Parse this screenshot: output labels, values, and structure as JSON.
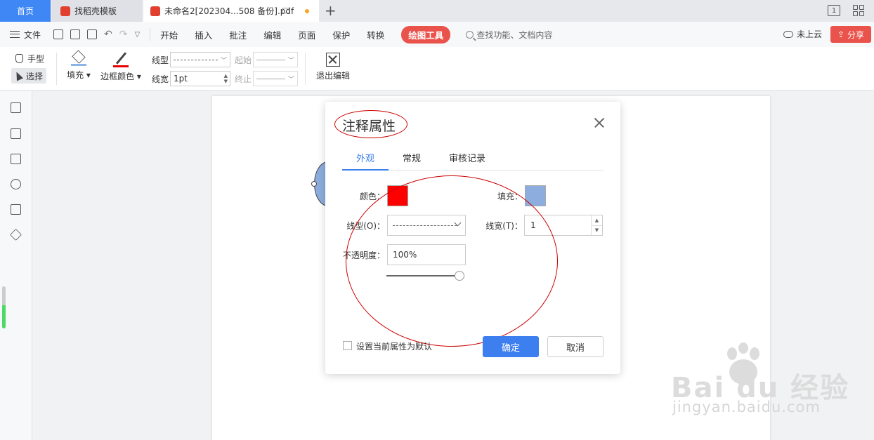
{
  "tabs": {
    "home": "首页",
    "template": "找稻壳模板",
    "document": "未命名2[202304...508 备份].pdf",
    "new_tab": "+"
  },
  "window_icons": {
    "page_indicator": "1"
  },
  "menubar": {
    "file": "文件",
    "items": [
      "开始",
      "插入",
      "批注",
      "编辑",
      "页面",
      "保护",
      "转换"
    ],
    "active": "绘图工具",
    "search": "查找功能、文档内容",
    "cloud": "未上云",
    "share": "分享"
  },
  "toolbar": {
    "hand": "手型",
    "select": "选择",
    "fill": "填充",
    "border_color": "边框颜色",
    "line_type": "线型",
    "line_width": "线宽",
    "line_width_value": "1pt",
    "start": "起始",
    "end": "终止",
    "exit_edit": "退出编辑",
    "fill_color": "#8cb4e6",
    "border_color_value": "#e60000"
  },
  "dialog": {
    "title": "注释属性",
    "tabs": [
      "外观",
      "常规",
      "审核记录"
    ],
    "active_tab": "外观",
    "color_label": "颜色：",
    "color_value": "#ff0000",
    "fill_label": "填充：",
    "fill_value": "#8caddd",
    "line_type_label": "线型(O)：",
    "line_width_label": "线宽(T)：",
    "line_width_value": "1",
    "opacity_label": "不透明度：",
    "opacity_value": "100%",
    "opacity_fraction": 1.0,
    "default_checkbox": "设置当前属性为默认",
    "ok": "确定",
    "cancel": "取消"
  },
  "watermark": {
    "brand": "Bai du 经验",
    "url": "jingyan.baidu.com"
  }
}
